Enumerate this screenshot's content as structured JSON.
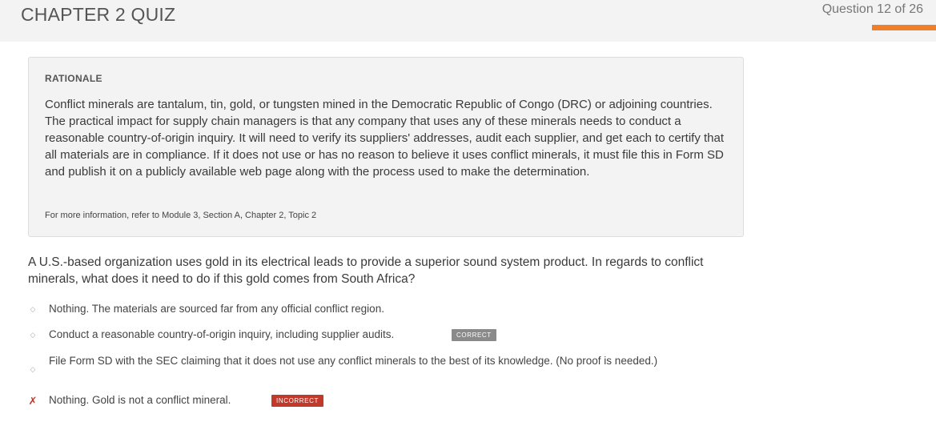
{
  "header": {
    "title": "CHAPTER 2 QUIZ",
    "question_counter": "Question 12 of 26",
    "progress_color": "#f07f2b"
  },
  "rationale": {
    "heading": "RATIONALE",
    "body": "Conflict minerals are tantalum, tin, gold, or tungsten mined in the Democratic Republic of Congo (DRC) or adjoining countries. The practical impact for supply chain managers is that any company that uses any of these minerals needs to conduct a reasonable country-of-origin inquiry. It will need to verify its suppliers' addresses, audit each supplier, and get each to certify that all materials are in compliance. If it does not use or has no reason to believe it uses conflict minerals, it must file this in Form SD and publish it on a publicly available web page along with the process used to make the determination.",
    "reference": "For more information, refer to Module 3, Section A, Chapter 2, Topic 2"
  },
  "question": {
    "text": "A U.S.-based organization uses gold in its electrical leads to provide a superior sound system product. In regards to conflict minerals, what does it need to do if this gold comes from South Africa?"
  },
  "options": [
    {
      "text": "Nothing. The materials are sourced far from any official conflict region.",
      "marker": "diamond-bullet-icon"
    },
    {
      "text": "Conduct a reasonable country-of-origin inquiry, including supplier audits.",
      "marker": "diamond-bullet-icon",
      "badge": "CORRECT"
    },
    {
      "text": "File Form SD with the SEC claiming that it does not use any conflict minerals to the best of its knowledge. (No proof is needed.)",
      "marker": "diamond-bullet-icon"
    },
    {
      "text": "Nothing. Gold is not a conflict mineral.",
      "marker": "x-mark-icon",
      "badge": "INCORRECT"
    }
  ],
  "colors": {
    "correct_badge": "#8a8a8a",
    "incorrect_badge": "#c0392b",
    "incorrect_mark": "#c0392b"
  }
}
